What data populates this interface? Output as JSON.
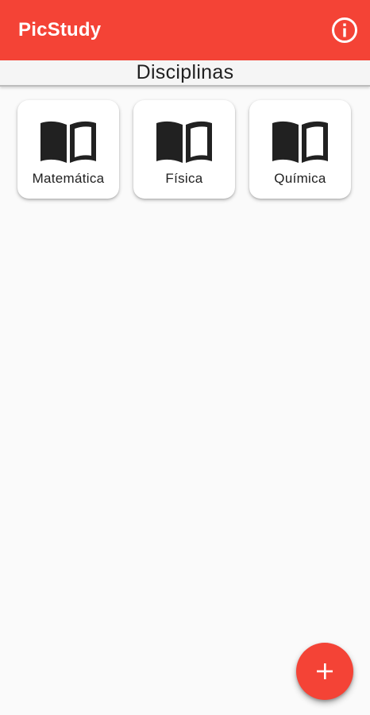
{
  "app": {
    "title": "PicStudy",
    "primary_color": "#f44336",
    "info_icon": "info-icon"
  },
  "section": {
    "title": "Disciplinas"
  },
  "subjects": [
    {
      "label": "Matemática",
      "icon": "book-open-icon"
    },
    {
      "label": "Física",
      "icon": "book-open-icon"
    },
    {
      "label": "Química",
      "icon": "book-open-icon"
    }
  ],
  "fab": {
    "icon": "plus-icon"
  }
}
